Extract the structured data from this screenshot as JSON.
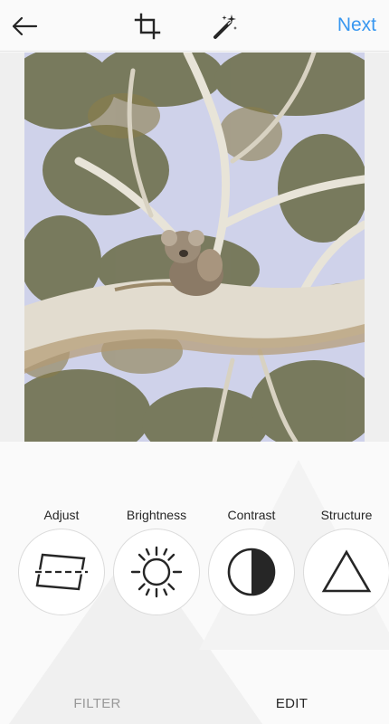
{
  "header": {
    "back_icon": "arrow-left-icon",
    "crop_icon": "crop-icon",
    "magic_icon": "magic-wand-icon",
    "next_label": "Next",
    "accent_color": "#3897f0"
  },
  "photo": {
    "subject": "koala in eucalyptus tree"
  },
  "tools": [
    {
      "label": "Adjust",
      "icon": "adjust-icon"
    },
    {
      "label": "Brightness",
      "icon": "brightness-icon"
    },
    {
      "label": "Contrast",
      "icon": "contrast-icon"
    },
    {
      "label": "Structure",
      "icon": "structure-icon"
    }
  ],
  "tabs": {
    "filter_label": "FILTER",
    "edit_label": "EDIT",
    "active": "EDIT"
  }
}
